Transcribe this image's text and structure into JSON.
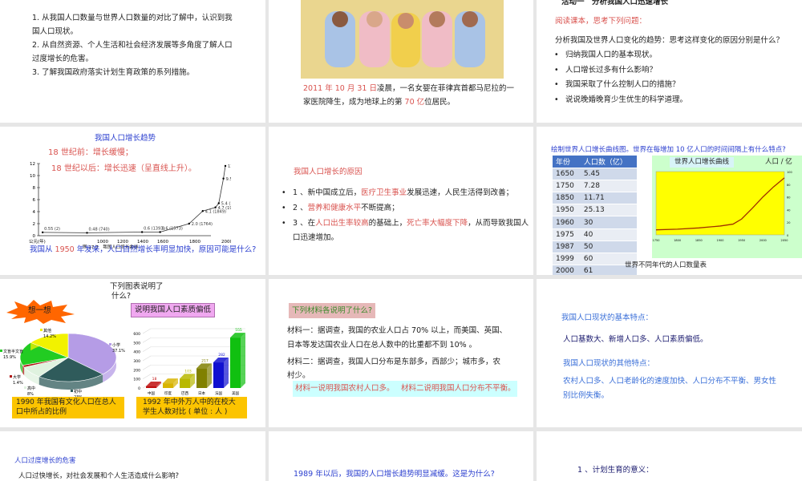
{
  "slides": {
    "s1": {
      "lines": [
        "1. 从我国人口数量与世界人口数量的对比了解中，认识到我",
        "国人口现状。",
        "2. 从自然资源、个人生活和社会经济发展等多角度了解人口",
        "过度增长的危害。",
        "3. 了解我国政府落实计划生育政策的系列措施。"
      ]
    },
    "s2": {
      "caption_red1": "2011 年 10 月 31 日",
      "caption_1": "凌晨，一名女婴在菲律宾首都马尼拉的一",
      "caption_2a": "家医院降生，成为地球上的第 ",
      "caption_red2": "70 亿",
      "caption_2b": "位居民。"
    },
    "s3": {
      "title": "活动一　分析我国人口迅速增长",
      "subtitle": "阅读课本，思考下列问题：",
      "question": "分析我国及世界人口变化的趋势：思考这样变化的原因分别是什么？",
      "bullets": [
        "归纳我国人口的基本现状。",
        "人口增长过多有什么影响？",
        "我国采取了什么控制人口的措施？",
        "说说晚婚晚育少生优生的科学道理。"
      ]
    },
    "s4": {
      "title": "我国人口增长趋势",
      "red1": "18 世纪前：增长缓慢；",
      "red2": "18 世纪以后：增长迅速（呈直线上升）。",
      "q_a": "我国从 ",
      "q_red": "1950",
      "q_b": " 年发来，人口自然增长率明显加快，原因可能是什么?"
    },
    "s5": {
      "title": "我国人口增长的原因",
      "b1_a": "1 、新中国成立后，",
      "b1_red": "医疗卫生事业",
      "b1_b": "发展迅速，人民生活得到改善；",
      "b2_a": "2 、",
      "b2_red": "营养和健康水平",
      "b2_b": "不断提高；",
      "b3_a": "3 、在",
      "b3_red1": "人口出生率较高",
      "b3_b": "的基础上，",
      "b3_red2": "死亡率大幅度下降",
      "b3_c": "，从而导致我国人",
      "b3_d": "口迅速增加。"
    },
    "s6": {
      "question": "绘制世界人口增长曲线图。世界在每增加 10 亿人口的时间间隔上有什么特点?",
      "table_caption": "世界不同年代的人口数量表",
      "chart_title": "世界人口增长曲线",
      "chart_unit": "人口 / 亿"
    },
    "s7": {
      "question_1": "下列图表说明了",
      "question_2": "什么?",
      "burst": "想一想",
      "answer": "说明我国人口素质偏低",
      "label_pie": "1990 年我国有文化人口在总人口中所占的比例",
      "label_bar": "1992 年中外万人中的在校大学生人数对比 ( 单位 : 人 )"
    },
    "s8": {
      "title": "下列材料各说明了什么?",
      "m1": "材料一：据调查，我国的农业人口占 70% 以上，而美国、英国、",
      "m1b": "日本等发达国农业人口在总人数中的比重都不到 10% 。",
      "m2": "材料二：据调查，我国人口分布是东部多，西部少；城市多，农",
      "m2b": "村少。",
      "ans1": "材料一说明我国农村人口多。",
      "ans2": "材料二说明我国人口分布不平衡。"
    },
    "s9": {
      "h1": "我国人口现状的基本特点：",
      "t1": "人口基数大、新增人口多、人口素质偏低。",
      "h2": "我国人口现状的其他特点：",
      "t2a": "农村人口多、人口老龄化的速度加快、人口分布不平衡、男女性",
      "t2b": "别比例失衡。"
    },
    "s10": {
      "title": "人口过度增长的危害",
      "text": "人口过快增长，对社会发展和个人生活造成什么影响?"
    },
    "s11": {
      "text": "1989 年以后，我国的人口增长趋势明显减缓。这是为什么?"
    },
    "s12": {
      "text": "1 、计划生育的意义："
    }
  },
  "chart_data": [
    {
      "type": "line",
      "title": "我国人口增长曲线",
      "caption": "图 17-7　我国人口增长曲线",
      "xlabel": "公元(年)",
      "ylabel": "",
      "ylim": [
        0,
        12
      ],
      "yticks": [
        "0",
        "2",
        "4",
        "6",
        "8",
        "10",
        "12"
      ],
      "xticks": [
        "1000",
        "1200",
        "1400",
        "1600",
        "1800",
        "2000"
      ],
      "points": [
        {
          "year": 2,
          "value": 0.55,
          "label": "0.55 (2)"
        },
        {
          "year": 740,
          "value": 0.48,
          "label": "0.48 (740)"
        },
        {
          "year": 1393,
          "value": 0.6,
          "label": "0.6 (1393)"
        },
        {
          "year": 1573,
          "value": 0.6,
          "label": "0.6 (1573)"
        },
        {
          "year": 1764,
          "value": 2.0,
          "label": "2.0 (1764)"
        },
        {
          "year": 1849,
          "value": 4.1,
          "label": "4.1 (1849)"
        },
        {
          "year": 1928,
          "value": 4.7,
          "label": "4.7 (1928)"
        },
        {
          "year": 1949,
          "value": 5.4,
          "label": "5.4 (1949)"
        },
        {
          "year": 1978,
          "value": 9.5,
          "label": "9.5 (1978)"
        },
        {
          "year": 1990,
          "value": 11.6,
          "label": "11.6 (1990)"
        }
      ]
    },
    {
      "type": "table",
      "columns": [
        "年份",
        "人口数（亿）"
      ],
      "rows": [
        [
          "1650",
          "5.45"
        ],
        [
          "1750",
          "7.28"
        ],
        [
          "1850",
          "11.71"
        ],
        [
          "1950",
          "25.13"
        ],
        [
          "1960",
          "30"
        ],
        [
          "1975",
          "40"
        ],
        [
          "1987",
          "50"
        ],
        [
          "1999",
          "60"
        ],
        [
          "2000",
          "61"
        ]
      ]
    },
    {
      "type": "line",
      "title": "世界人口增长曲线",
      "ylabel": "人口 / 亿",
      "xlim": [
        1750,
        2050
      ],
      "ylim": [
        0,
        100
      ],
      "xticks": [
        "1750",
        "1800",
        "1850",
        "1900",
        "1950",
        "2000",
        "2050"
      ],
      "yticks": [
        "0",
        "20",
        "40",
        "60",
        "80",
        "100"
      ],
      "x": [
        1750,
        1800,
        1850,
        1900,
        1930,
        1950,
        1975,
        2000,
        2025,
        2050
      ],
      "y": [
        8,
        9,
        11,
        14,
        17,
        25,
        42,
        60,
        76,
        90
      ]
    },
    {
      "type": "pie",
      "title": "1990 年我国有文化人口在总人口中所占的比例",
      "slices": [
        {
          "label": "小学",
          "value": 37.1,
          "text": "37.1%",
          "color": "#b59ce6"
        },
        {
          "label": "初中",
          "value": 23,
          "text": "23%",
          "color": "#2f5b5b"
        },
        {
          "label": "高中",
          "value": 8,
          "text": "8%",
          "color": "#dff2df"
        },
        {
          "label": "大学",
          "value": 1.4,
          "text": "1.4%",
          "color": "#b01515"
        },
        {
          "label": "文盲半文盲",
          "value": 15.9,
          "text": "15.9%",
          "color": "#22cc22"
        },
        {
          "label": "其他",
          "value": 14.2,
          "text": "14.2%",
          "color": "#f2f200"
        }
      ]
    },
    {
      "type": "bar",
      "title": "1992 年中外万人中的在校大学生人数对比 ( 单位 : 人 )",
      "categories": [
        "中国",
        "印度",
        "巴西",
        "日本",
        "法国",
        "美国"
      ],
      "values": [
        18,
        52,
        103,
        217,
        282,
        555
      ],
      "labels": [
        "18",
        "",
        "103",
        "217",
        "282",
        "555"
      ],
      "colors": [
        "#c01010",
        "#d8b400",
        "#b8b800",
        "#808000",
        "#1010d0",
        "#10c010"
      ],
      "ylim": [
        0,
        600
      ],
      "yticks": [
        "0",
        "100",
        "200",
        "300",
        "400",
        "500",
        "600"
      ]
    }
  ]
}
